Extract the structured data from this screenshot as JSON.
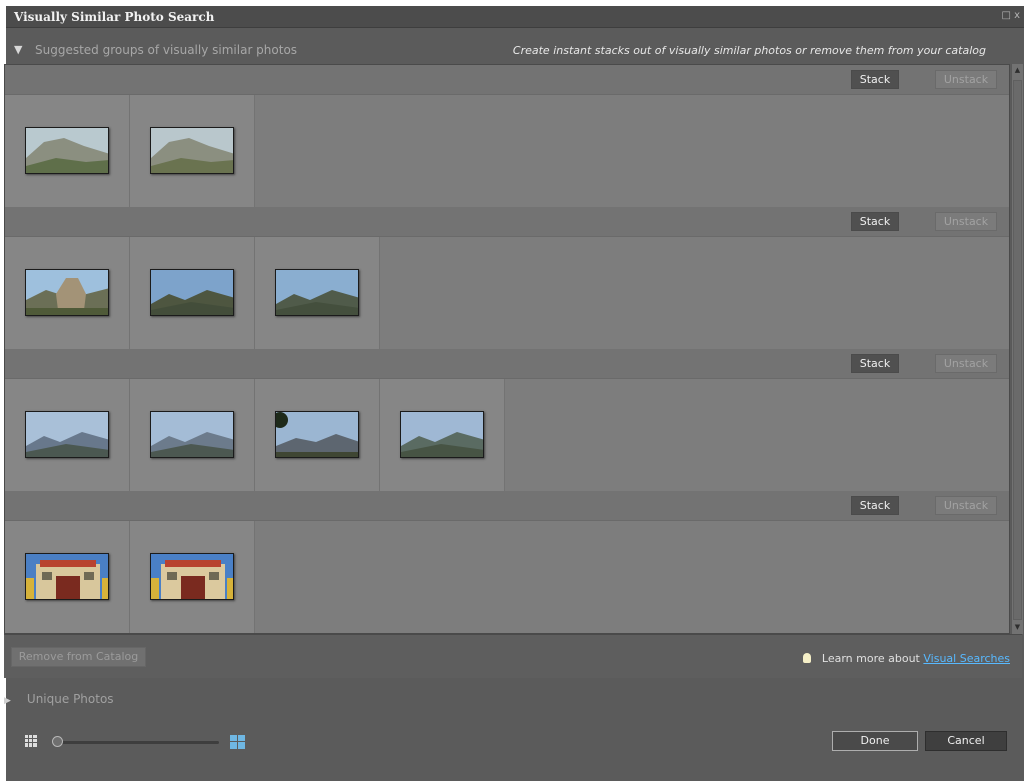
{
  "window": {
    "title": "Visually Similar Photo Search",
    "controls": "□ x"
  },
  "suggested": {
    "toggle_glyph": "▼",
    "label": "Suggested groups of visually similar photos",
    "hint": "Create instant stacks out of visually similar photos or remove them from your catalog"
  },
  "group_buttons": {
    "stack_label": "Stack",
    "unstack_label": "Unstack"
  },
  "groups": [
    {
      "photos": [
        {
          "subject": "hillside-town",
          "sky": "#b9c9cf",
          "ground": "#5f6f4a"
        },
        {
          "subject": "hillside-town",
          "sky": "#b9c7cc",
          "ground": "#6a7350"
        }
      ]
    },
    {
      "photos": [
        {
          "subject": "stupa-mountains",
          "sky": "#9ec0dd",
          "ground": "#6b6f56"
        },
        {
          "subject": "mountain-range",
          "sky": "#7da3cb",
          "ground": "#4e5640"
        },
        {
          "subject": "mountain-range",
          "sky": "#8aaed0",
          "ground": "#505b4a"
        }
      ]
    },
    {
      "photos": [
        {
          "subject": "mountain-range",
          "sky": "#a9c0d8",
          "ground": "#68788c"
        },
        {
          "subject": "mountain-range",
          "sky": "#a4bcd6",
          "ground": "#6c7b8c"
        },
        {
          "subject": "mountain-range-tree",
          "sky": "#9bb6d2",
          "ground": "#5d6670"
        },
        {
          "subject": "mountain-range",
          "sky": "#9fb8d4",
          "ground": "#5a6b62"
        }
      ]
    },
    {
      "photos": [
        {
          "subject": "monastery-gate",
          "sky": "#4a7fc4",
          "ground": "#d8c79c"
        },
        {
          "subject": "monastery-gate",
          "sky": "#4a80c6",
          "ground": "#dbc99e"
        }
      ]
    }
  ],
  "footer": {
    "remove_label": "Remove from Catalog",
    "learn_prefix": "Learn more about",
    "learn_link": "Visual Searches",
    "bulb_icon": "lightbulb-icon"
  },
  "unique": {
    "toggle_glyph": "▶",
    "label": "Unique Photos"
  },
  "zoom": {
    "level": 0,
    "small_icon": "small-grid-icon",
    "large_icon": "large-grid-icon"
  },
  "dialog": {
    "done_label": "Done",
    "cancel_label": "Cancel"
  },
  "colors": {
    "link": "#58b9ff",
    "large_grid_accent": "#6fb7e3"
  }
}
